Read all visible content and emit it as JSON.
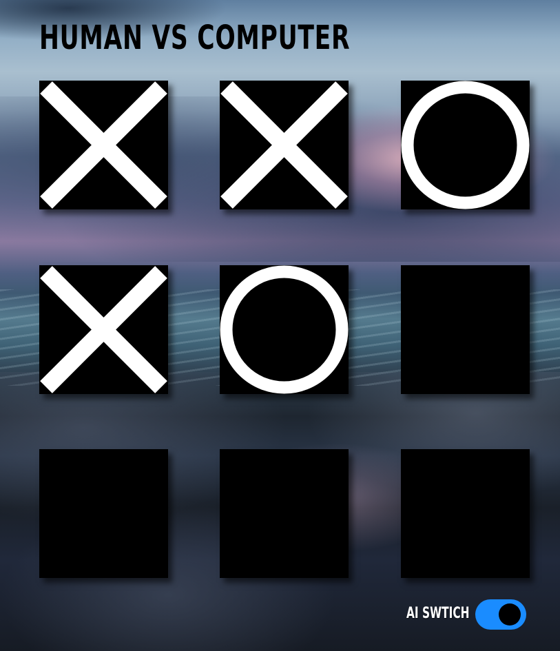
{
  "title": "HUMAN VS COMPUTER",
  "board": {
    "cells": [
      "X",
      "X",
      "O",
      "X",
      "O",
      "",
      "",
      "",
      ""
    ]
  },
  "ai_switch": {
    "label": "AI SWTICH",
    "enabled": true,
    "on_color": "#1a8cff"
  },
  "colors": {
    "cell_background": "#000000",
    "mark_color": "#ffffff"
  }
}
